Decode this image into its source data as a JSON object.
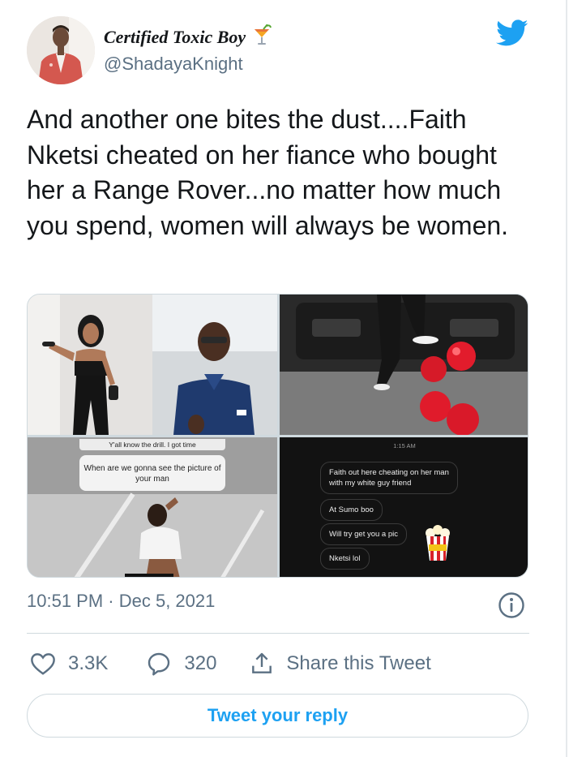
{
  "author": {
    "display_name": "Certified Toxic Boy",
    "handle": "@ShadayaKnight",
    "name_emoji": "tropical-drink-icon"
  },
  "tweet": {
    "text": "And another one bites the dust....Faith Nketsi cheated on her fiance who bought her a Range Rover...no matter how much you spend, women will always be women.",
    "timestamp": "10:51 PM · Dec 5, 2021"
  },
  "media": {
    "story": {
      "header": "Y'all know the drill. I got time",
      "question": "When are we gonna see the picture of your man"
    },
    "dm": {
      "time": "1:15 AM",
      "messages": [
        "Faith out here cheating on her man with my white guy friend",
        "At Sumo boo",
        "Will try get you a pic",
        "Nketsi lol"
      ]
    }
  },
  "actions": {
    "likes": "3.3K",
    "replies": "320",
    "share_label": "Share this Tweet"
  },
  "reply_button": "Tweet your reply",
  "colors": {
    "twitter_blue": "#1da1f2",
    "secondary_text": "#5b7083",
    "border": "#cfd9de"
  }
}
